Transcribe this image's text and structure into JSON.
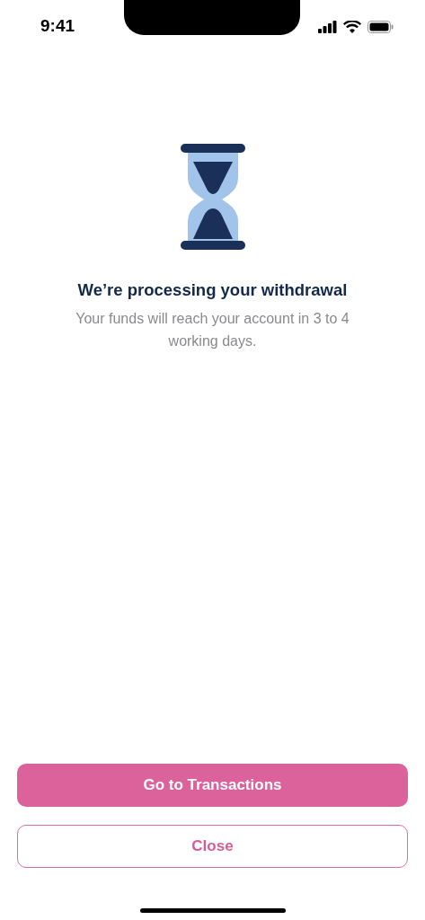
{
  "status_bar": {
    "time": "9:41"
  },
  "message": {
    "title": "We’re processing your withdrawal",
    "body": "Your funds will reach your account in 3 to 4 working days."
  },
  "buttons": [
    {
      "label": "Go to Transactions",
      "kind": "primary"
    },
    {
      "label": "Close",
      "kind": "outline"
    }
  ]
}
